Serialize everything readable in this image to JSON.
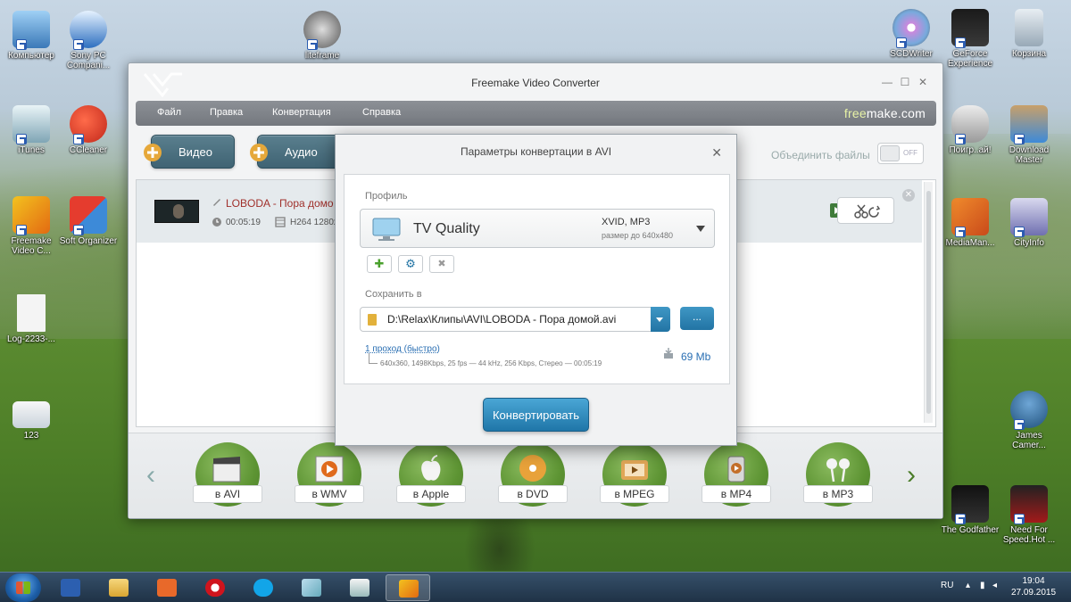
{
  "desktop": {
    "icons_left": [
      {
        "label": "Компьютер"
      },
      {
        "label": "Sony PC Compani..."
      },
      {
        "label": "iTunes"
      },
      {
        "label": "CCleaner"
      },
      {
        "label": "Freemake Video C..."
      },
      {
        "label": "Soft Organizer"
      },
      {
        "label": "Log-2233-..."
      },
      {
        "label": "123"
      }
    ],
    "icons_right": [
      {
        "label": "SCDWriter"
      },
      {
        "label": "GeForce Experience"
      },
      {
        "label": "Корзина"
      },
      {
        "label": "Поигр..ай!"
      },
      {
        "label": "Download Master"
      },
      {
        "label": "MediaMan..."
      },
      {
        "label": "CityInfo"
      },
      {
        "label": "James Camer..."
      },
      {
        "label": "The Godfather"
      },
      {
        "label": "Need For Speed.Hot ..."
      }
    ],
    "icon_top_center": {
      "label": "liteframe"
    }
  },
  "window": {
    "title": "Freemake Video Converter",
    "controls": {
      "minimize": "—",
      "maximize": "☐",
      "close": "✕"
    },
    "menu": [
      "Файл",
      "Правка",
      "Конвертация",
      "Справка"
    ],
    "brand": {
      "free": "free",
      "make": "make.com"
    },
    "add_buttons": {
      "video": "Видео",
      "audio": "Аудио"
    },
    "merge": {
      "label": "Объединить файлы",
      "state": "OFF"
    },
    "file": {
      "name": "LOBODA - Пора домо",
      "duration": "00:05:19",
      "codec": "H264  1280x"
    },
    "formats": [
      "в AVI",
      "в WMV",
      "в Apple",
      "в DVD",
      "в MPEG",
      "в MP4",
      "в MP3"
    ]
  },
  "dialog": {
    "title": "Параметры конвертации в AVI",
    "close": "✕",
    "profile_label": "Профиль",
    "profile": {
      "name": "TV Quality",
      "codec": "XVID, MP3",
      "size": "размер до 640x480"
    },
    "buttons": {
      "add": "✚",
      "settings": "⚙",
      "delete": "✖"
    },
    "save_label": "Сохранить в",
    "path": "D:\\Relax\\Клипы\\AVI\\LOBODA - Пора домой.avi",
    "browse": "...",
    "pass": "1 проход (быстро)",
    "details": "640x360, 1498Kbps, 25 fps — 44 kHz, 256 Kbps, Стерео — 00:05:19",
    "size": "69 Mb",
    "convert": "Конвертировать"
  },
  "taskbar": {
    "lang": "RU",
    "time": "19:04",
    "date": "27.09.2015"
  },
  "colors": {
    "accent_blue": "#2274a4",
    "format_green": "#5d9433",
    "filename_red": "#a0302b"
  }
}
